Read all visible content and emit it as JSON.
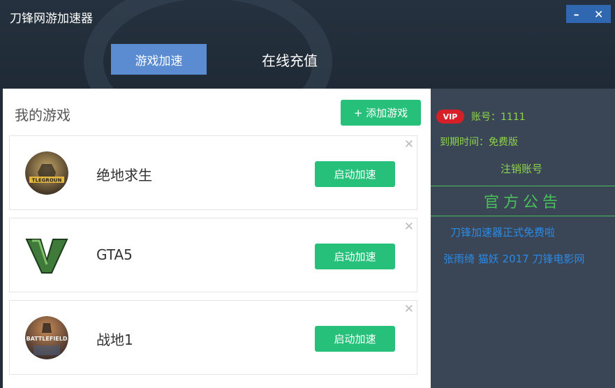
{
  "app": {
    "title": "刀锋网游加速器"
  },
  "window_controls": {
    "minimize": "–",
    "close": "✕"
  },
  "tabs": [
    {
      "label": "游戏加速",
      "active": true
    },
    {
      "label": "在线充值",
      "active": false
    }
  ],
  "main": {
    "title": "我的游戏",
    "add_button": "+ 添加游戏",
    "games": [
      {
        "name": "绝地求生",
        "icon_text": "PLAYERUNKNOWN'S BATTLEGROUNDS",
        "button": "启动加速",
        "close": "✕",
        "icon": "pubg-icon"
      },
      {
        "name": "GTA5",
        "icon_text": "V",
        "button": "启动加速",
        "close": "✕",
        "icon": "gta5-icon"
      },
      {
        "name": "战地1",
        "icon_text": "BATTLEFIELD",
        "button": "启动加速",
        "close": "✕",
        "icon": "battlefield-icon"
      }
    ]
  },
  "sidebar": {
    "vip_badge": "VIP",
    "account": "账号：1111",
    "expire": "到期时间：免费版",
    "logout": "注销账号",
    "announcement_title": "官方公告",
    "news": [
      "刀锋加速器正式免费啦",
      "张雨绮 猫妖 2017 刀锋电影网"
    ]
  },
  "colors": {
    "accent_green": "#27c07a",
    "tab_blue": "#5b8bd0",
    "header": "#222d3a",
    "sidebar": "#3a4656",
    "vip_red": "#d61f26",
    "link_blue": "#2b8ae6"
  }
}
